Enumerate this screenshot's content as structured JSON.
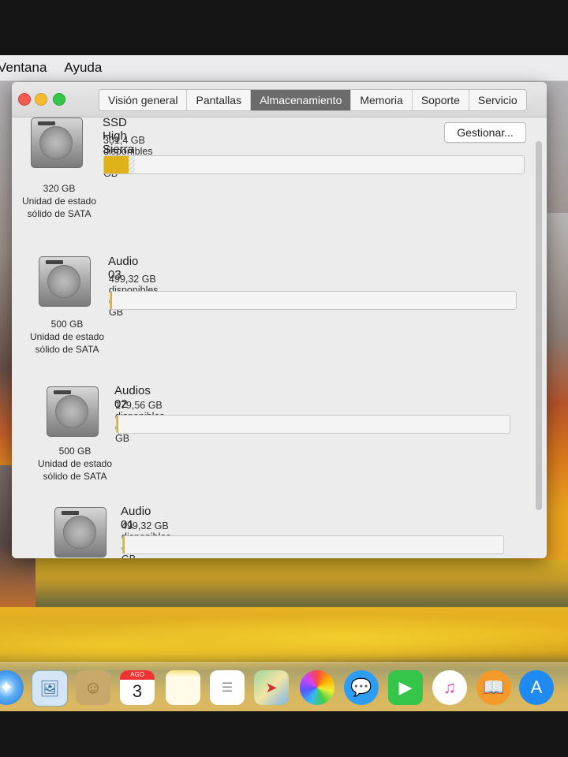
{
  "menubar": {
    "items": [
      "Ventana",
      "Ayuda"
    ]
  },
  "window": {
    "tabs": [
      {
        "label": "Visión general",
        "active": false
      },
      {
        "label": "Pantallas",
        "active": false
      },
      {
        "label": "Almacenamiento",
        "active": true
      },
      {
        "label": "Memoria",
        "active": false
      },
      {
        "label": "Soporte",
        "active": false
      },
      {
        "label": "Servicio",
        "active": false
      }
    ],
    "manage_label": "Gestionar..."
  },
  "volumes": [
    {
      "name": "SSD High Sierra",
      "available": "301,4 GB disponibles de 319,9 GB",
      "size": "320 GB",
      "type_line1": "Unidad de estado",
      "type_line2": "sólido de SATA",
      "used_fraction": 0.058
    },
    {
      "name": "Audio 03",
      "available": "499,32 GB disponibles de 499,76 GB",
      "size": "500 GB",
      "type_line1": "Unidad de estado",
      "type_line2": "sólido de SATA",
      "used_fraction": 0.001
    },
    {
      "name": "Audios 02",
      "available": "179,56 GB disponibles de 179,87 GB",
      "size": "500 GB",
      "type_line1": "Unidad de estado",
      "type_line2": "sólido de SATA",
      "used_fraction": 0.002
    },
    {
      "name": "Audio 01",
      "available": "499,32 GB disponibles de 499,76 GB",
      "size": "",
      "type_line1": "",
      "type_line2": "",
      "used_fraction": 0.001
    }
  ],
  "dock": {
    "icons": [
      "safari-icon",
      "preview-icon",
      "contacts-icon",
      "calendar-icon",
      "notes-icon",
      "reminders-icon",
      "maps-icon",
      "photos-icon",
      "messages-icon",
      "facetime-icon",
      "itunes-icon",
      "ibooks-icon",
      "app-store-icon"
    ],
    "calendar_month": "AGO",
    "calendar_day": "3"
  },
  "colors": {
    "used_bar": "#e0b21a",
    "active_tab": "#6b6b6b",
    "close": "#f25a52",
    "minimize": "#f4bd30",
    "zoom": "#35c54a"
  }
}
